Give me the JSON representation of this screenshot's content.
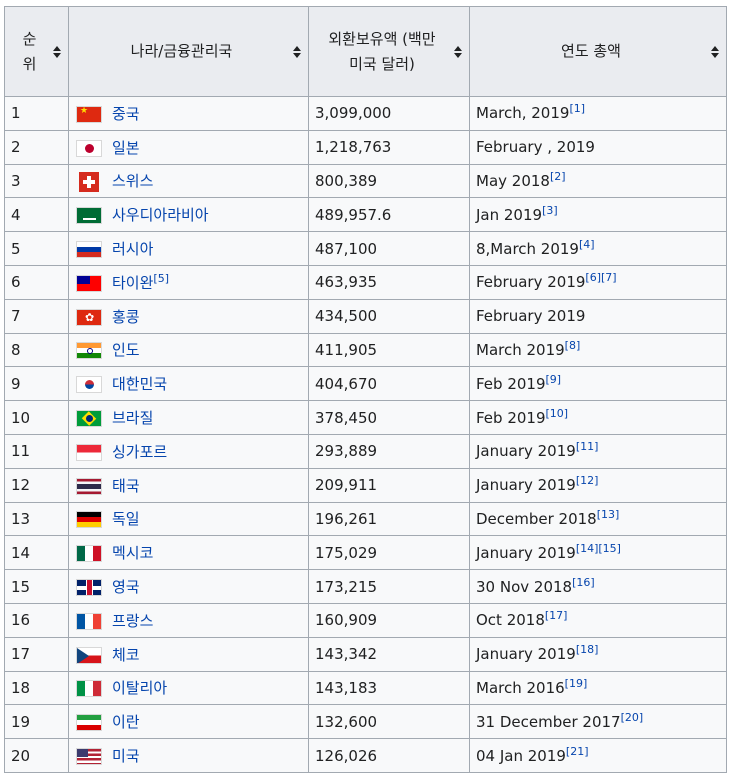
{
  "headers": {
    "rank": "순위",
    "country": "나라/금융관리국",
    "reserves": "외환보유액 (백만 미국 달러)",
    "date": "연도 총액"
  },
  "rows": [
    {
      "rank": "1",
      "flag": "china-flag-icon",
      "country": "중국",
      "country_ref": "",
      "value": "3,099,000",
      "date": "March, 2019",
      "refs": "[1]"
    },
    {
      "rank": "2",
      "flag": "japan-flag-icon",
      "country": "일본",
      "country_ref": "",
      "value": "1,218,763",
      "date": "February , 2019",
      "refs": ""
    },
    {
      "rank": "3",
      "flag": "switzerland-flag-icon",
      "country": "스위스",
      "country_ref": "",
      "value": "800,389",
      "date": "May 2018",
      "refs": "[2]"
    },
    {
      "rank": "4",
      "flag": "saudi-arabia-flag-icon",
      "country": "사우디아라비아",
      "country_ref": "",
      "value": "489,957.6",
      "date": "Jan 2019",
      "refs": "[3]"
    },
    {
      "rank": "5",
      "flag": "russia-flag-icon",
      "country": "러시아",
      "country_ref": "",
      "value": "487,100",
      "date": "8,March 2019",
      "refs": "[4]"
    },
    {
      "rank": "6",
      "flag": "taiwan-flag-icon",
      "country": "타이완",
      "country_ref": "[5]",
      "value": "463,935",
      "date": "February 2019",
      "refs": "[6][7]"
    },
    {
      "rank": "7",
      "flag": "hong-kong-flag-icon",
      "country": "홍콩",
      "country_ref": "",
      "value": "434,500",
      "date": "February 2019",
      "refs": ""
    },
    {
      "rank": "8",
      "flag": "india-flag-icon",
      "country": "인도",
      "country_ref": "",
      "value": "411,905",
      "date": "March 2019",
      "refs": "[8]"
    },
    {
      "rank": "9",
      "flag": "south-korea-flag-icon",
      "country": "대한민국",
      "country_ref": "",
      "value": "404,670",
      "date": "Feb 2019",
      "refs": "[9]"
    },
    {
      "rank": "10",
      "flag": "brazil-flag-icon",
      "country": "브라질",
      "country_ref": "",
      "value": "378,450",
      "date": "Feb 2019",
      "refs": "[10]"
    },
    {
      "rank": "11",
      "flag": "singapore-flag-icon",
      "country": "싱가포르",
      "country_ref": "",
      "value": "293,889",
      "date": "January 2019",
      "refs": "[11]"
    },
    {
      "rank": "12",
      "flag": "thailand-flag-icon",
      "country": "태국",
      "country_ref": "",
      "value": "209,911",
      "date": "January 2019",
      "refs": "[12]"
    },
    {
      "rank": "13",
      "flag": "germany-flag-icon",
      "country": "독일",
      "country_ref": "",
      "value": "196,261",
      "date": "December 2018",
      "refs": "[13]"
    },
    {
      "rank": "14",
      "flag": "mexico-flag-icon",
      "country": "멕시코",
      "country_ref": "",
      "value": "175,029",
      "date": "January 2019",
      "refs": "[14][15]"
    },
    {
      "rank": "15",
      "flag": "united-kingdom-flag-icon",
      "country": "영국",
      "country_ref": "",
      "value": "173,215",
      "date": "30 Nov 2018",
      "refs": "[16]"
    },
    {
      "rank": "16",
      "flag": "france-flag-icon",
      "country": "프랑스",
      "country_ref": "",
      "value": "160,909",
      "date": "Oct 2018",
      "refs": "[17]"
    },
    {
      "rank": "17",
      "flag": "czech-republic-flag-icon",
      "country": "체코",
      "country_ref": "",
      "value": "143,342",
      "date": "January 2019",
      "refs": "[18]"
    },
    {
      "rank": "18",
      "flag": "italy-flag-icon",
      "country": "이탈리아",
      "country_ref": "",
      "value": "143,183",
      "date": "March 2016",
      "refs": "[19]"
    },
    {
      "rank": "19",
      "flag": "iran-flag-icon",
      "country": "이란",
      "country_ref": "",
      "value": "132,600",
      "date": "31 December 2017",
      "refs": "[20]"
    },
    {
      "rank": "20",
      "flag": "united-states-flag-icon",
      "country": "미국",
      "country_ref": "",
      "value": "126,026",
      "date": "04 Jan 2019",
      "refs": "[21]"
    }
  ],
  "colors": {
    "header_bg": "#eaecf0",
    "cell_bg": "#f8f9fa",
    "border": "#a2a9b1",
    "link": "#0645ad"
  }
}
